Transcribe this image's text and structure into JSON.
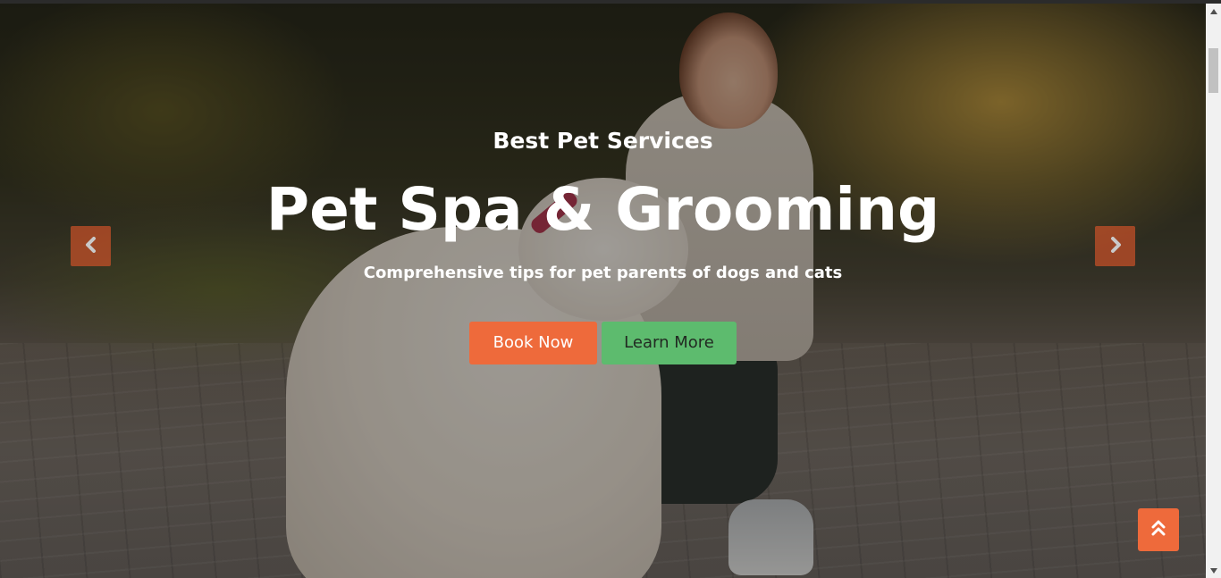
{
  "hero": {
    "eyebrow": "Best Pet Services",
    "headline": "Pet Spa & Grooming",
    "subtitle": "Comprehensive tips for pet parents of dogs and cats",
    "primary_button": "Book Now",
    "secondary_button": "Learn More"
  },
  "carousel": {
    "prev_icon": "chevron-left-icon",
    "next_icon": "chevron-right-icon"
  },
  "back_to_top": {
    "icon": "double-chevron-up-icon"
  },
  "colors": {
    "accent_orange": "#ee6a3b",
    "accent_green": "#5dbb6e",
    "text_white": "#ffffff"
  }
}
